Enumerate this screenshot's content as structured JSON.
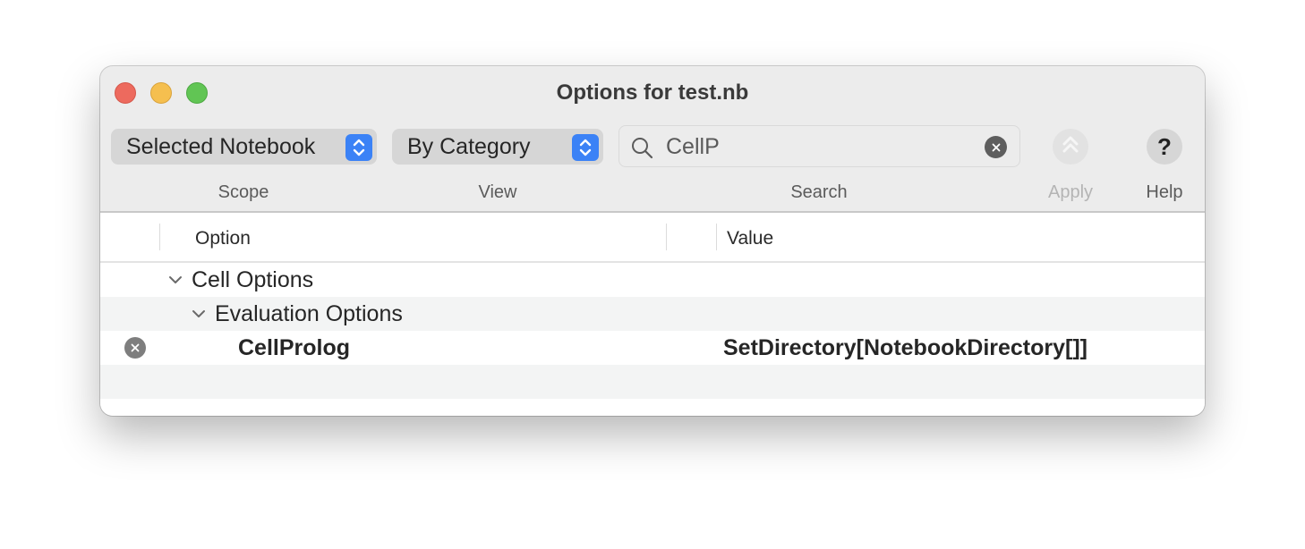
{
  "window": {
    "title": "Options for test.nb",
    "traffic_lights": {
      "close": "#ed6a5e",
      "minimize": "#f5bf4f",
      "maximize": "#61c554"
    }
  },
  "toolbar": {
    "scope": {
      "selected": "Selected Notebook",
      "label": "Scope"
    },
    "view": {
      "selected": "By Category",
      "label": "View"
    },
    "search": {
      "value": "CellP",
      "placeholder": "",
      "label": "Search"
    },
    "apply": {
      "label": "Apply",
      "icon": "double-chevron-up-icon",
      "enabled": false
    },
    "help": {
      "label": "Help",
      "glyph": "?"
    },
    "accent_color": "#3b82f6"
  },
  "table": {
    "columns": [
      "Option",
      "Value"
    ],
    "rows": [
      {
        "type": "group",
        "level": 0,
        "expanded": true,
        "option": "Cell Options",
        "value": ""
      },
      {
        "type": "group",
        "level": 1,
        "expanded": true,
        "option": "Evaluation Options",
        "value": ""
      },
      {
        "type": "setting",
        "level": 2,
        "removable": true,
        "option": "CellProlog",
        "value": "SetDirectory[NotebookDirectory[]]"
      }
    ]
  }
}
